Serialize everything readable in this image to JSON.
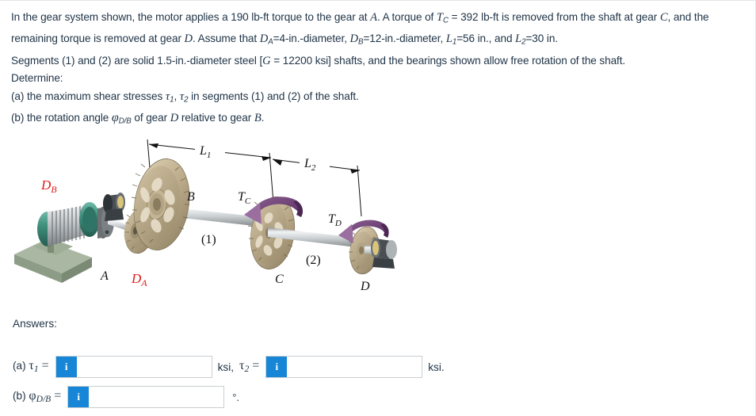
{
  "problem": {
    "line1_a": "In the gear system shown, the motor applies a 190 lb-ft torque to the gear at ",
    "line1_A": "A",
    "line1_b": ". A torque of ",
    "line1_T": "T",
    "line1_Tsub": "C",
    "line1_c": " = 392 lb-ft is removed from the shaft at gear ",
    "line1_C": "C",
    "line1_d": ", and the remaining torque is removed at gear ",
    "line1_D": "D",
    "line1_e": ". Assume that ",
    "line1_DA": "D",
    "line1_DAsub": "A",
    "line1_f": "=4-in.-diameter, ",
    "line1_DB": "D",
    "line1_DBsub": "B",
    "line1_g": "=12-in.-diameter, ",
    "line1_L1": "L",
    "line1_L1sub": "1",
    "line1_h": "=56 in., and ",
    "line1_L2": "L",
    "line1_L2sub": "2",
    "line1_i": "=30 in.",
    "line3_a": "Segments (1) and (2) are solid 1.5-in.-diameter steel [",
    "line3_G": "G",
    "line3_b": " = 12200 ksi] shafts, and the bearings shown allow free rotation of the shaft.",
    "line4": "Determine:",
    "line5_a": "(a) the maximum shear stresses ",
    "line5_t1": "τ",
    "line5_t1sub": "1",
    "line5_b": ", ",
    "line5_t2": "τ",
    "line5_t2sub": "2",
    "line5_c": " in segments (1) and (2) of the shaft.",
    "line6_a": "(b) the rotation angle ",
    "line6_phi": "φ",
    "line6_phisub": "D/B",
    "line6_b": " of gear ",
    "line6_D": "D",
    "line6_c": " relative to gear ",
    "line6_B": "B",
    "line6_d": "."
  },
  "figure": {
    "alt": "gear-shaft-system-diagram",
    "labels": {
      "L1": "L",
      "L1_sub": "1",
      "L2": "L",
      "L2_sub": "2",
      "DB": "D",
      "DB_sub": "B",
      "DA": "D",
      "DA_sub": "A",
      "A": "A",
      "B": "B",
      "C": "C",
      "D": "D",
      "TC": "T",
      "TC_sub": "C",
      "TD": "T",
      "TD_sub": "D",
      "seg1": "(1)",
      "seg2": "(2)"
    },
    "colors": {
      "red_label": "#e01b1b",
      "gear_gold": "#bfae8e",
      "gear_gold_dark": "#8f8164",
      "motor_green": "#3f8f7d",
      "motor_base": "#9aab93",
      "shaft_gray": "#c9ccce",
      "torque_purple": "#6d3f74",
      "bearing_dark": "#3a3f44"
    }
  },
  "answers": {
    "heading": "Answers:",
    "row_a": {
      "prefix": "(a) ",
      "symbol": "τ",
      "symbol_sub": "1",
      "equals": " =",
      "info": "i",
      "value1": "",
      "placeholder1": "",
      "unit_mid": "ksi, ",
      "symbol2": "τ",
      "symbol2_sub": "2",
      "equals2": " =",
      "info2": "i",
      "value2": "",
      "placeholder2": "",
      "unit_end": "ksi."
    },
    "row_b": {
      "prefix": "(b) ",
      "symbol": "φ",
      "symbol_sub": "D/B",
      "equals": " =",
      "info": "i",
      "value": "",
      "placeholder": "",
      "unit_end": "°."
    }
  },
  "theme": {
    "accent_blue": "#1786d6",
    "text_color": "#1f3346",
    "field_border": "#c9ced2"
  }
}
